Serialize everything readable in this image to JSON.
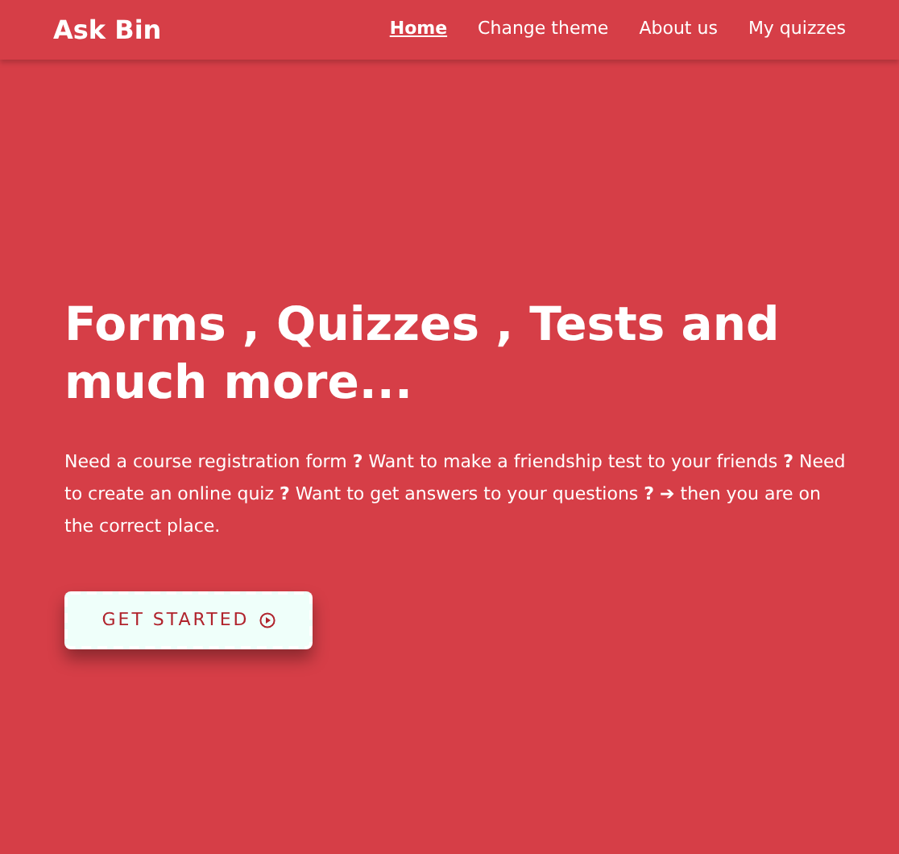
{
  "brand": "Ask Bin",
  "nav": [
    {
      "label": "Home",
      "selected": true
    },
    {
      "label": "Change theme",
      "selected": false
    },
    {
      "label": "About us",
      "selected": false
    },
    {
      "label": "My quizzes",
      "selected": false
    }
  ],
  "hero": {
    "title": "Forms , Quizzes , Tests and much more...",
    "text": "Need a course registration form **?** Want to make a friendship test to your friends **?** Need to create an online quiz **?** Want to get answers to your questions **?** ➔ then you are on the correct place.",
    "button": "GET STARTED"
  }
}
